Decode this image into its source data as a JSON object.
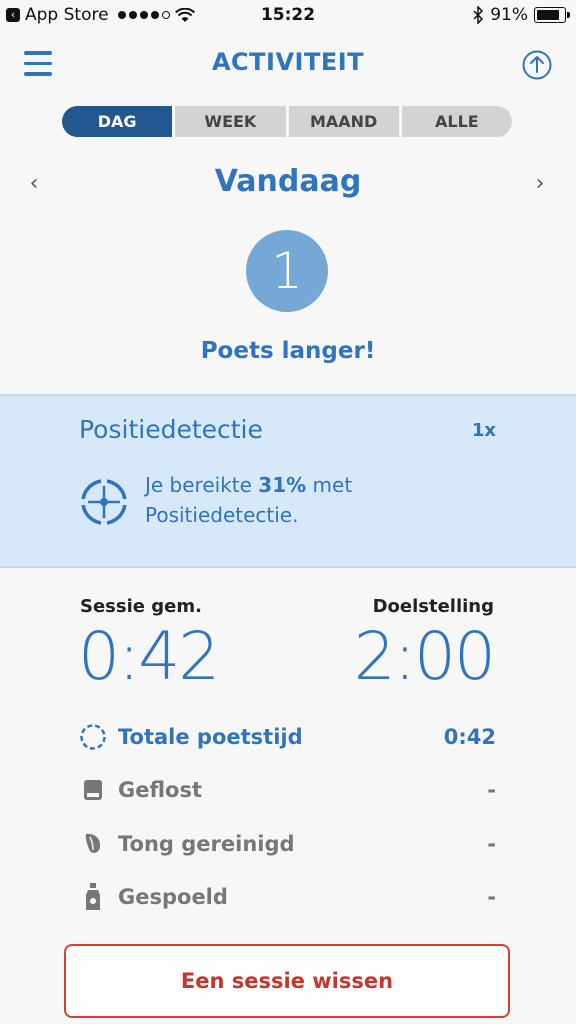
{
  "status_bar": {
    "back_label": "App Store",
    "time": "15:22",
    "battery": "91%",
    "battery_level": 0.91
  },
  "nav": {
    "title": "ACTIVITEIT"
  },
  "tabs": [
    "DAG",
    "WEEK",
    "MAAND",
    "ALLE"
  ],
  "active_tab": "DAG",
  "date_title": "Vandaag",
  "badge_number": "1",
  "headline": "Poets langer!",
  "position_panel": {
    "title": "Positiedetectie",
    "count": "1x",
    "text_before": "Je bereikte",
    "percent": "31%",
    "text_after": "met Positiedetectie."
  },
  "stats": {
    "session_label": "Sessie gem.",
    "session_value": "0:42",
    "goal_label": "Doelstelling",
    "goal_value": "2:00"
  },
  "rows": [
    {
      "icon": "timer-icon",
      "label": "Totale poetstijd",
      "value": "0:42"
    },
    {
      "icon": "floss-icon",
      "label": "Geflost",
      "value": "-"
    },
    {
      "icon": "tongue-icon",
      "label": "Tong gereinigd",
      "value": "-"
    },
    {
      "icon": "mouthwash-icon",
      "label": "Gespoeld",
      "value": "-"
    }
  ],
  "clear_button": "Een sessie wissen",
  "colors": {
    "accent": "#2f74bf",
    "active_tab": "#22578f",
    "panel_bg": "#d7e9f8",
    "danger": "#c7362a"
  }
}
